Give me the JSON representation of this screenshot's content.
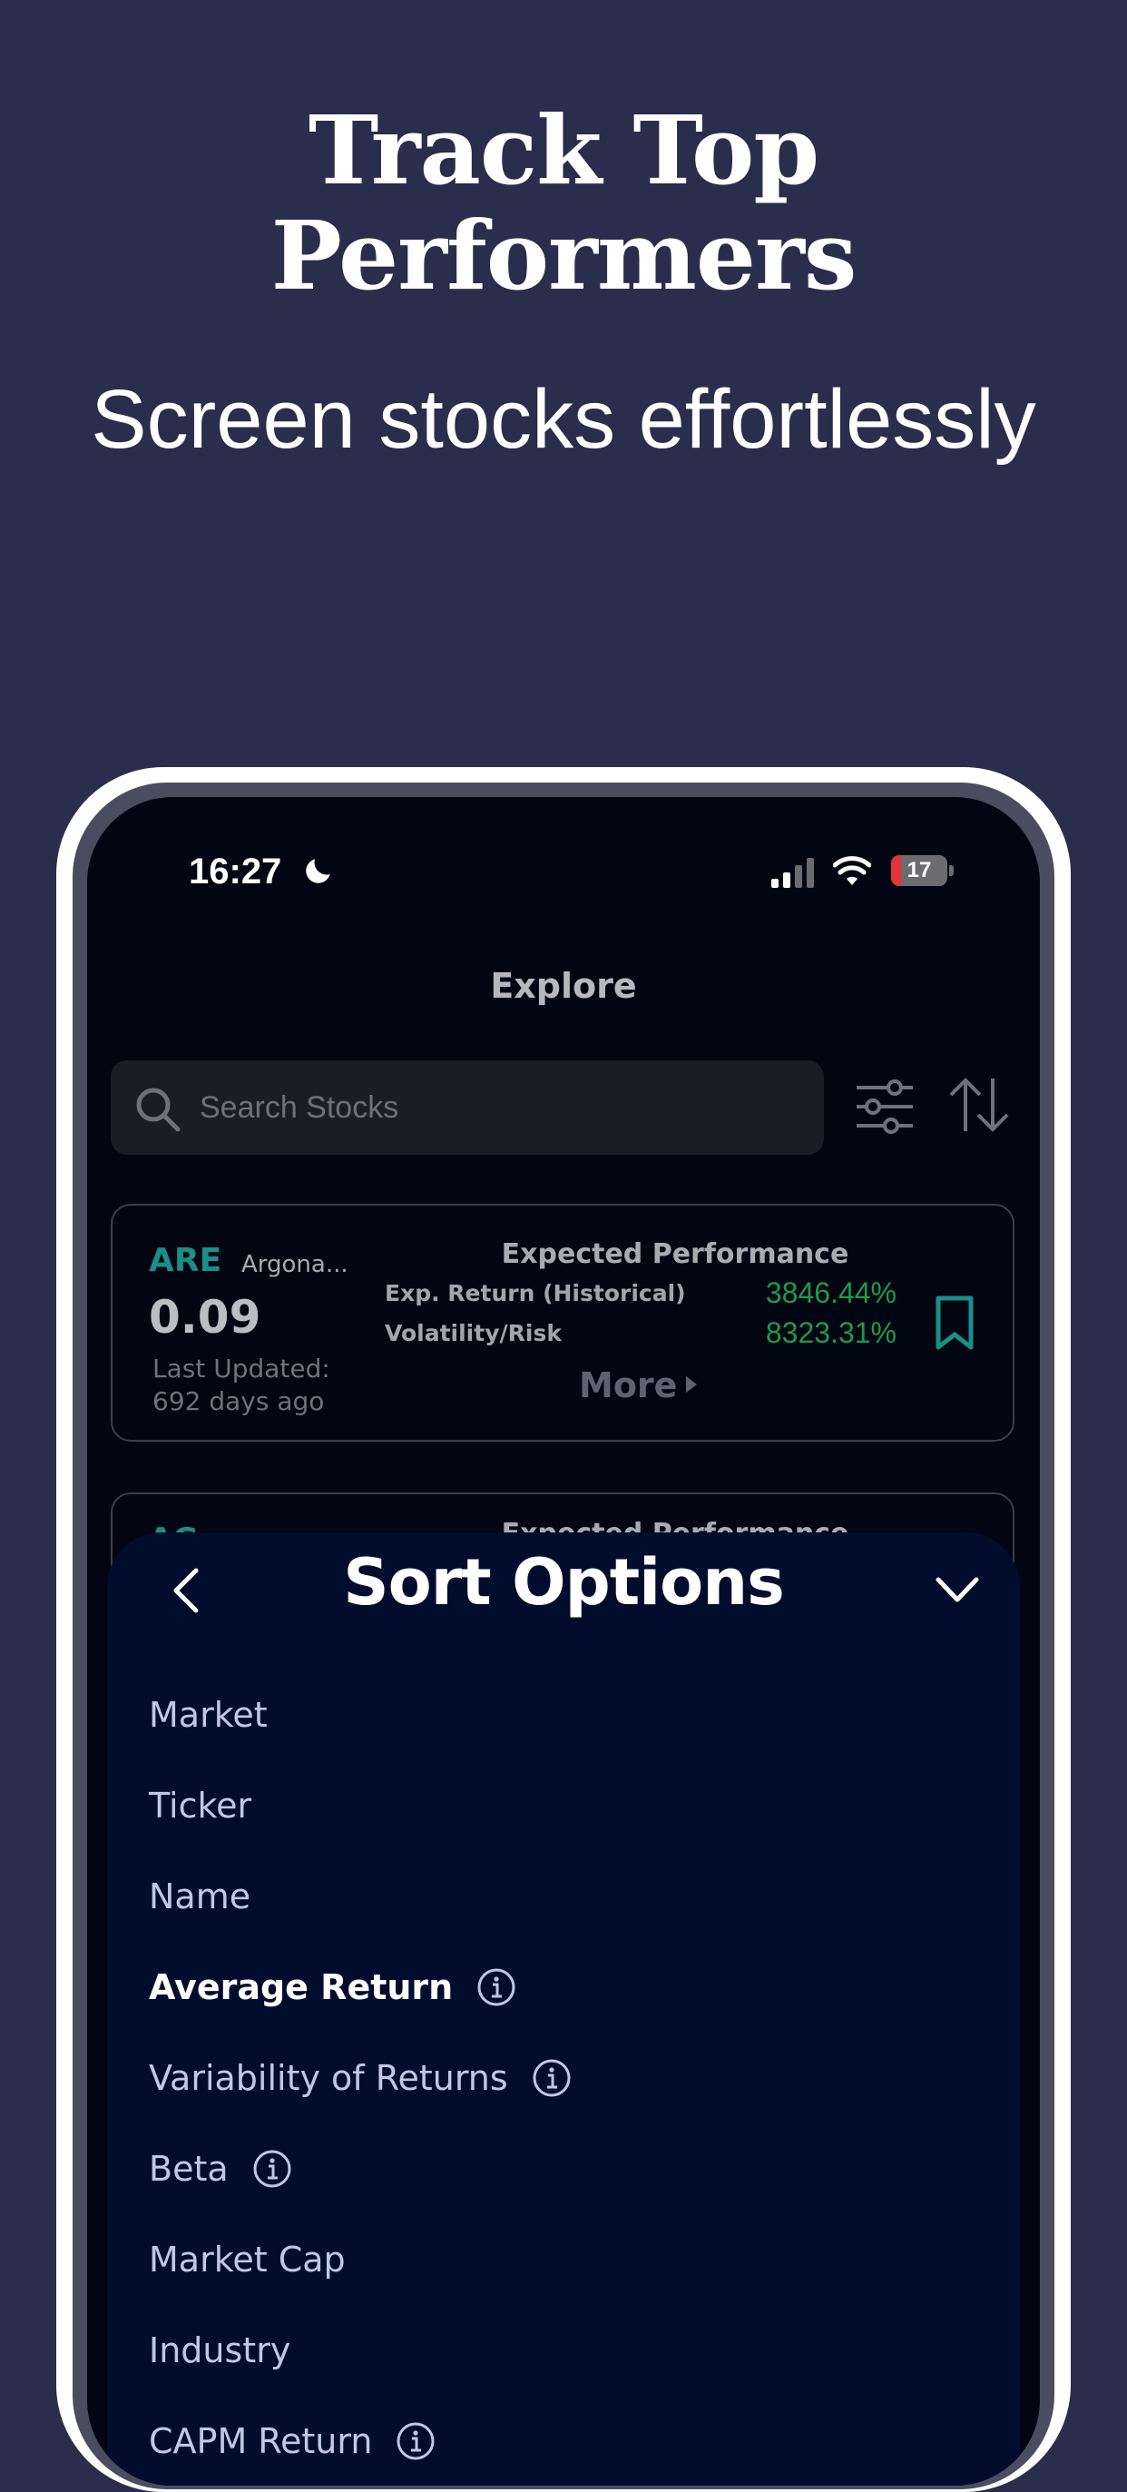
{
  "hero": {
    "title": "Track Top Performers",
    "subtitle": "Screen stocks effortlessly"
  },
  "status_bar": {
    "time": "16:27",
    "battery": 17,
    "battery_color": "#e4333b"
  },
  "header": {
    "title": "Explore"
  },
  "search": {
    "placeholder": "Search Stocks"
  },
  "stock_card": {
    "ticker": "ARE",
    "company": "Argona...",
    "price": "0.09",
    "updated_label": "Last Updated:",
    "updated_value": "692 days ago",
    "performance_title": "Expected Performance",
    "metrics": [
      {
        "label": "Exp. Return (Historical)",
        "value": "3846.44%"
      },
      {
        "label": "Volatility/Risk",
        "value": "8323.31%"
      }
    ],
    "more_label": "More",
    "accent_color": "#1a8f86",
    "positive_color": "#1e9a4a"
  },
  "stock_card_2": {
    "ticker": "AG",
    "performance_title": "Expected Performance"
  },
  "sort_sheet": {
    "title": "Sort Options",
    "options": [
      {
        "label": "Market",
        "info": false,
        "selected": false
      },
      {
        "label": "Ticker",
        "info": false,
        "selected": false
      },
      {
        "label": "Name",
        "info": false,
        "selected": false
      },
      {
        "label": "Average Return",
        "info": true,
        "selected": true
      },
      {
        "label": "Variability of Returns",
        "info": true,
        "selected": false
      },
      {
        "label": "Beta",
        "info": true,
        "selected": false
      },
      {
        "label": "Market Cap",
        "info": false,
        "selected": false
      },
      {
        "label": "Industry",
        "info": false,
        "selected": false
      },
      {
        "label": "CAPM Return",
        "info": true,
        "selected": false
      }
    ]
  },
  "colors": {
    "background": "#2b2d4d",
    "sheet": "#020d2e",
    "screen": "#020613"
  },
  "icons": [
    "moon-icon",
    "signal-icon",
    "wifi-icon",
    "search-icon",
    "filter-icon",
    "sort-icon",
    "bookmark-icon",
    "back-icon",
    "chevron-down-icon",
    "info-icon"
  ]
}
